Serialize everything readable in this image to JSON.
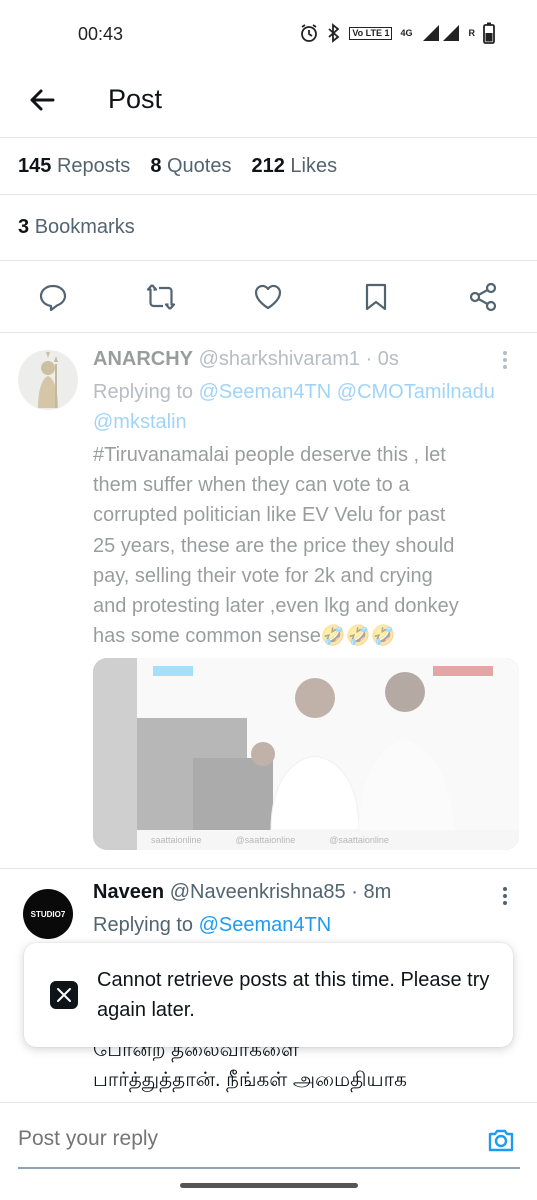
{
  "status_bar": {
    "time": "00:43",
    "volte_label": "Vo LTE 1",
    "network_label": "4G",
    "roaming_label": "R",
    "icons": [
      "alarm-icon",
      "bluetooth-icon",
      "signal-icon",
      "battery-icon"
    ]
  },
  "header": {
    "title": "Post"
  },
  "stats": {
    "reposts_count": "145",
    "reposts_label": "Reposts",
    "quotes_count": "8",
    "quotes_label": "Quotes",
    "likes_count": "212",
    "likes_label": "Likes",
    "bookmarks_count": "3",
    "bookmarks_label": "Bookmarks"
  },
  "actions": [
    "reply-icon",
    "repost-icon",
    "like-icon",
    "bookmark-icon",
    "share-icon"
  ],
  "replies": [
    {
      "name": "ANARCHY",
      "handle": "@sharkshivaram1 · 0s",
      "replying_prefix": "Replying to",
      "mention_1": "@Seeman4TN",
      "mention_2": "@CMOTamilnadu",
      "mention_3": "@mkstalin",
      "text_lines": [
        "#Tiruvanamalai people deserve this , let",
        "them suffer when they can vote to a",
        "corrupted politician like EV Velu for past",
        "25 years, these are the price they should",
        "pay, selling their vote for 2k and crying",
        "and protesting later ,even lkg and donkey",
        "has some common sense🤣🤣🤣"
      ],
      "media_captions": [
        "saattaionline",
        "@saattaionline",
        "@saattaionline"
      ]
    },
    {
      "name": "Naveen",
      "handle": "@Naveenkrishna85 · 8m",
      "replying_prefix": "Replying to",
      "mention_1": "@Seeman4TN",
      "avatar_text": "STUDIO7",
      "text_line_1": "போன்ற தலைவர்களை",
      "text_line_2": "பார்த்துத்தான். நீங்கள் அமைதியாக"
    }
  ],
  "toast": {
    "message": "Cannot retrieve posts at this time. Please try again later."
  },
  "compose": {
    "placeholder": "Post your reply"
  },
  "colors": {
    "accent": "#1d9bf0",
    "text": "#0f1419",
    "secondary": "#536471"
  }
}
